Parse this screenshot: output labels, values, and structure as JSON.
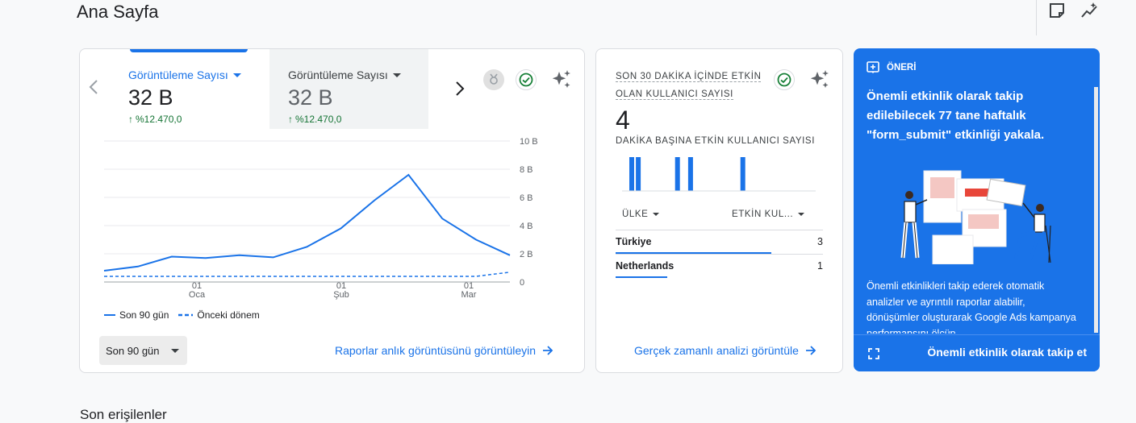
{
  "header": {
    "title": "Ana Sayfa"
  },
  "main_card": {
    "tab1": {
      "label": "Görüntüleme Sayısı",
      "value": "32 B",
      "change": "%12.470,0"
    },
    "tab2": {
      "label": "Görüntüleme Sayısı",
      "value": "32 B",
      "change": "%12.470,0"
    },
    "legend": {
      "current": "Son 90 gün",
      "previous": "Önceki dönem"
    },
    "range_button": "Son 90 gün",
    "link": "Raporlar anlık görüntüsünü görüntüleyin"
  },
  "chart_data": {
    "type": "line",
    "x_ticks": [
      {
        "day": "01",
        "month": "Oca"
      },
      {
        "day": "01",
        "month": "Şub"
      },
      {
        "day": "01",
        "month": "Mar"
      }
    ],
    "y_ticks": [
      "10 B",
      "8 B",
      "6 B",
      "4 B",
      "2 B",
      "0"
    ],
    "ylim": [
      0,
      10000
    ],
    "series": [
      {
        "name": "Son 90 gün",
        "style": "solid",
        "color": "#1a73e8",
        "values": [
          800,
          1100,
          1800,
          1700,
          1900,
          1750,
          2500,
          3800,
          5800,
          7600,
          4500,
          3000,
          1900
        ]
      },
      {
        "name": "Önceki dönem",
        "style": "dashed",
        "color": "#1a73e8",
        "values": [
          400,
          400,
          400,
          400,
          400,
          400,
          400,
          400,
          400,
          400,
          400,
          400,
          700
        ]
      }
    ]
  },
  "realtime": {
    "title_line1": "SON 30 DAKİKA İÇİNDE ETKİN",
    "title_line2": "OLAN KULLANICI SAYISI",
    "value": "4",
    "subtitle": "DAKİKA BAŞINA ETKİN KULLANICI SAYISI",
    "minute_bars": [
      1,
      1,
      0,
      0,
      0,
      0,
      0,
      1,
      0,
      1,
      0,
      0,
      0,
      0,
      0,
      0,
      0,
      1
    ],
    "col_country": "ÜLKE",
    "col_active": "ETKİN KUL...",
    "rows": [
      {
        "name": "Türkiye",
        "value": "3",
        "share": 0.75
      },
      {
        "name": "Netherlands",
        "value": "1",
        "share": 0.25
      }
    ],
    "link": "Gerçek zamanlı analizi görüntüle"
  },
  "recommendation": {
    "tag": "ÖNERİ",
    "heading": "Önemli etkinlik olarak takip edilebilecek 77 tane haftalık \"form_submit\" etkinliği yakala.",
    "body": "Önemli etkinlikleri takip ederek otomatik analizler ve ayrıntılı raporlar alabilir, dönüşümler oluşturarak Google Ads kampanya performansını ölçüp",
    "action": "Önemli etkinlik olarak takip et"
  },
  "footer": {
    "section_title": "Son erişilenler"
  }
}
